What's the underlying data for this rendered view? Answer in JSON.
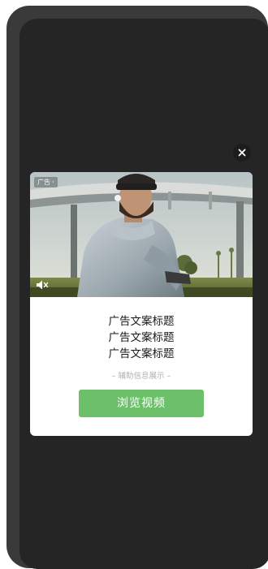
{
  "ad": {
    "badge_label": "广告",
    "title_lines": [
      "广告文案标题",
      "广告文案标题",
      "广告文案标题"
    ],
    "sub_info": "– 辅助信息展示 –",
    "cta_label": "浏览视频",
    "cta_color": "#6cc06a"
  },
  "icons": {
    "close": "close-icon",
    "mute": "speaker-muted-icon",
    "badge_chevron": "chevron-right-icon"
  }
}
